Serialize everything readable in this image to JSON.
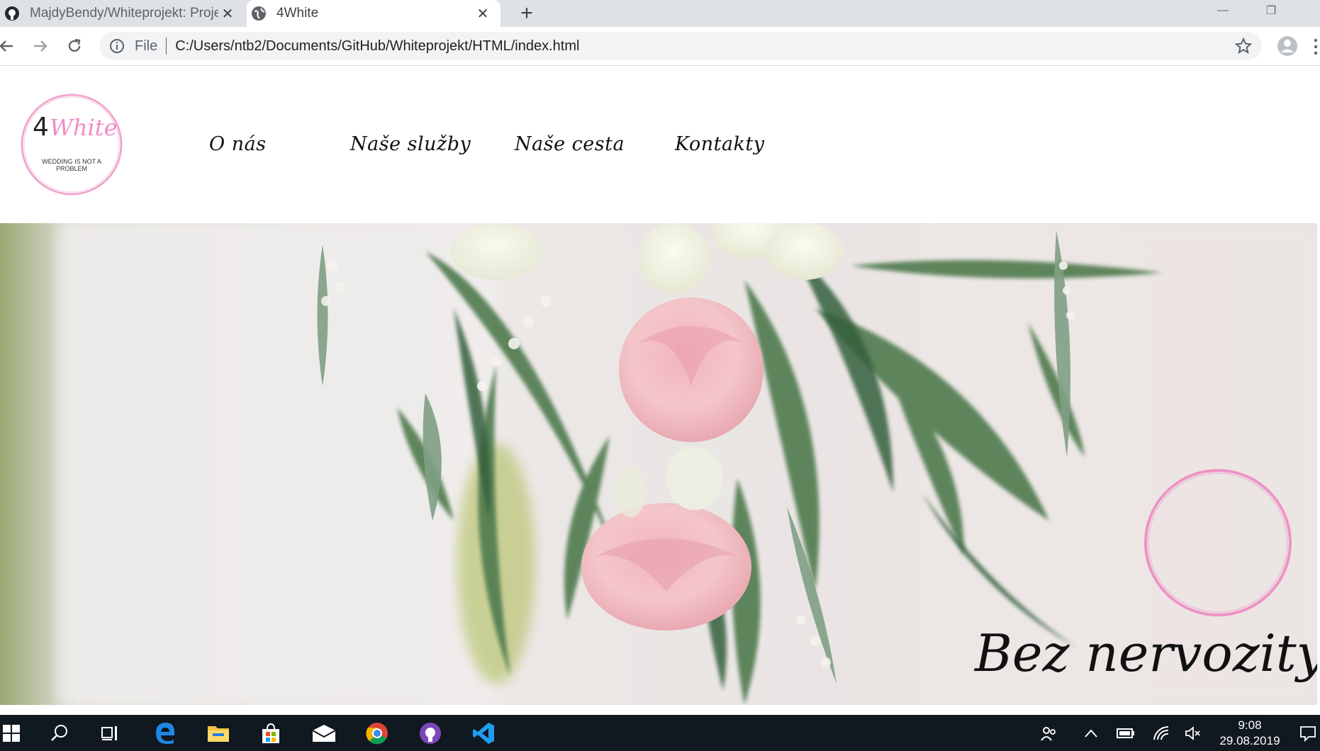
{
  "browser": {
    "tabs": [
      {
        "title": "MajdyBendy/Whiteprojekt: Projek",
        "icon": "github-icon",
        "active": false
      },
      {
        "title": "4White",
        "icon": "globe-icon",
        "active": true
      }
    ],
    "address": {
      "scheme_label": "File",
      "url": "C:/Users/ntb2/Documents/GitHub/Whiteprojekt/HTML/index.html"
    }
  },
  "site": {
    "logo": {
      "name_prefix": "4",
      "name_script": "White",
      "tagline_line1": "WEDDING IS NOT A",
      "tagline_line2": "PROBLEM",
      "ring_color": "#f0a6cf"
    },
    "nav": [
      "O nás",
      "Naše služby",
      "Naše cesta",
      "Kontakty"
    ],
    "hero": {
      "caption": "Bez nervozity",
      "circle_color": "#ee8fc4"
    }
  },
  "taskbar": {
    "apps": [
      "windows-start-icon",
      "search-icon",
      "task-view-icon",
      "edge-icon",
      "file-explorer-icon",
      "store-icon",
      "mail-icon",
      "chrome-icon",
      "github-desktop-icon",
      "vscode-icon"
    ],
    "clock": {
      "time": "9:08",
      "date": "29.08.2019"
    }
  }
}
